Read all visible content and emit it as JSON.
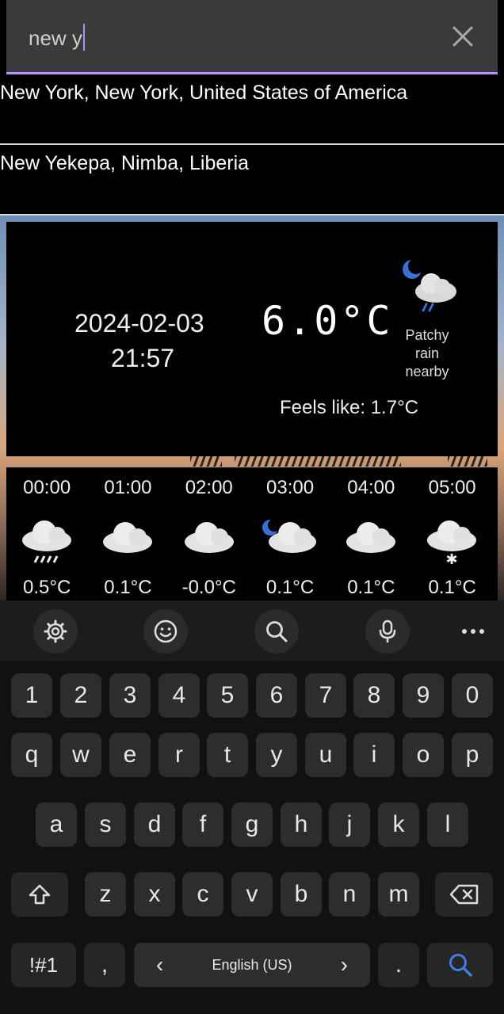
{
  "search": {
    "value": "new y"
  },
  "suggestions": [
    {
      "label": "New York, New York, United States of America"
    },
    {
      "label": "New Yekepa, Nimba, Liberia"
    }
  ],
  "current": {
    "date": "2024-02-03",
    "time": "21:57",
    "temperature": "6.0°C",
    "condition": "Patchy rain nearby",
    "feels_like": "Feels like: 1.7°C",
    "icon": "night-cloud-rain-icon"
  },
  "hourly": [
    {
      "time": "00:00",
      "temp": "0.5°C",
      "icon": "cloud-rain-icon"
    },
    {
      "time": "01:00",
      "temp": "0.1°C",
      "icon": "cloud-icon"
    },
    {
      "time": "02:00",
      "temp": "-0.0°C",
      "icon": "cloud-icon"
    },
    {
      "time": "03:00",
      "temp": "0.1°C",
      "icon": "night-cloud-icon"
    },
    {
      "time": "04:00",
      "temp": "0.1°C",
      "icon": "cloud-icon"
    },
    {
      "time": "05:00",
      "temp": "0.1°C",
      "icon": "cloud-snow-icon"
    }
  ],
  "keyboard": {
    "row_numbers": [
      "1",
      "2",
      "3",
      "4",
      "5",
      "6",
      "7",
      "8",
      "9",
      "0"
    ],
    "row_1": [
      "q",
      "w",
      "e",
      "r",
      "t",
      "y",
      "u",
      "i",
      "o",
      "p"
    ],
    "row_2": [
      "a",
      "s",
      "d",
      "f",
      "g",
      "h",
      "j",
      "k",
      "l"
    ],
    "row_3": [
      "z",
      "x",
      "c",
      "v",
      "b",
      "n",
      "m"
    ],
    "symbols_label": "!#1",
    "comma": ",",
    "period": ".",
    "language": "English (US)",
    "lang_prev": "‹",
    "lang_next": "›"
  },
  "colors": {
    "accent": "#b58cff",
    "search_key": "#3f7de0"
  }
}
